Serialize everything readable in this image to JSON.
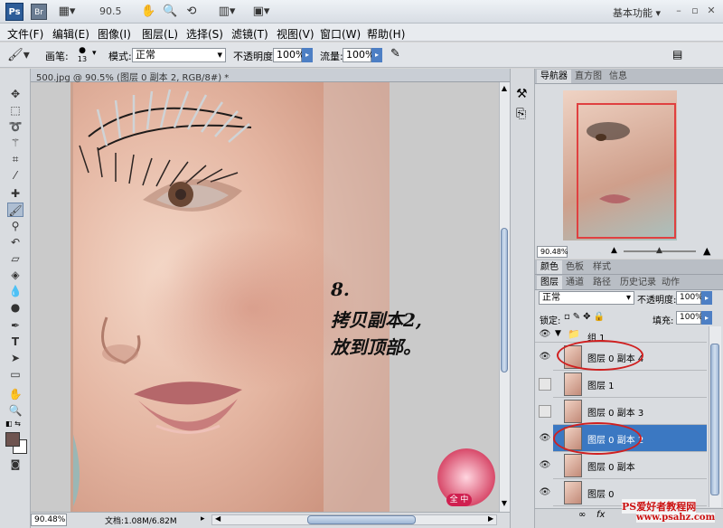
{
  "app": {
    "logo": "Ps",
    "bridge": "Br",
    "zoom": "90.5",
    "workspace": "基本功能",
    "window_controls": [
      "–",
      "▫",
      "✕"
    ]
  },
  "menu": [
    "文件(F)",
    "编辑(E)",
    "图像(I)",
    "图层(L)",
    "选择(S)",
    "滤镜(T)",
    "视图(V)",
    "窗口(W)",
    "帮助(H)"
  ],
  "options": {
    "brush_label": "画笔:",
    "brush_size": "13",
    "mode_label": "模式:",
    "mode_value": "正常",
    "opacity_label": "不透明度:",
    "opacity_value": "100%",
    "flow_label": "流量:",
    "flow_value": "100%"
  },
  "document": {
    "tab_title": "500.jpg @ 90.5% (图层 0 副本 2, RGB/8#) *",
    "annotation_line1": "8.",
    "annotation_line2": "拷贝副本2,",
    "annotation_line3": "放到顶部。",
    "status_zoom": "90.48%",
    "status_doc": "文档:1.08M/6.82M"
  },
  "navigator": {
    "tabs": [
      "导航器",
      "直方图",
      "信息"
    ],
    "zoom": "90.48%"
  },
  "color_tabs": [
    "颜色",
    "色板",
    "样式"
  ],
  "layers_panel": {
    "tabs": [
      "图层",
      "通道",
      "路径",
      "历史记录",
      "动作"
    ],
    "blend_mode": "正常",
    "opacity_label": "不透明度:",
    "opacity_value": "100%",
    "lock_label": "锁定:",
    "fill_label": "填充:",
    "fill_value": "100%",
    "group_name": "组 1",
    "layers": [
      {
        "name": "图层 0 副本 4",
        "visible": true,
        "selected": false
      },
      {
        "name": "图层 1",
        "visible": false,
        "selected": false
      },
      {
        "name": "图层 0 副本 3",
        "visible": false,
        "selected": false
      },
      {
        "name": "图层 0 副本 2",
        "visible": true,
        "selected": true
      },
      {
        "name": "图层 0 副本",
        "visible": true,
        "selected": false
      },
      {
        "name": "图层 0",
        "visible": true,
        "selected": false
      }
    ]
  },
  "watermark": {
    "line1": "PS爱好者教程网",
    "line2": "www.psahz.com",
    "badge": "全 中"
  },
  "colors": {
    "selection": "#3b78c2",
    "annotation_circle": "#d02020",
    "nav_box": "#e04040"
  }
}
